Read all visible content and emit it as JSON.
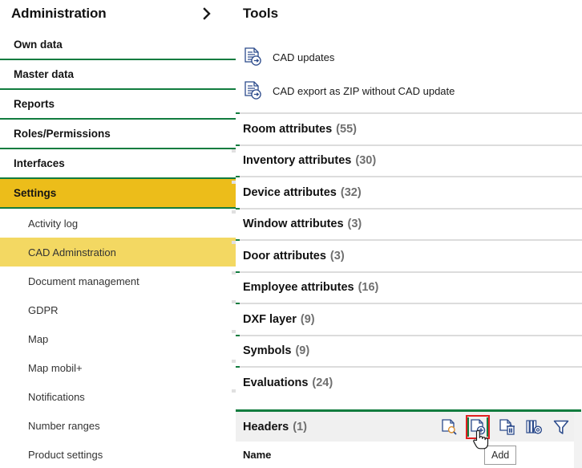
{
  "sidebar": {
    "title": "Administration",
    "expand_icon": "chevron-right-icon",
    "items": [
      {
        "label": "Own data",
        "level": "top",
        "active": false
      },
      {
        "label": "Master data",
        "level": "top",
        "active": false
      },
      {
        "label": "Reports",
        "level": "top",
        "active": false
      },
      {
        "label": "Roles/Permissions",
        "level": "top",
        "active": false
      },
      {
        "label": "Interfaces",
        "level": "top",
        "active": false
      },
      {
        "label": "Settings",
        "level": "top",
        "active": true
      },
      {
        "label": "Activity log",
        "level": "sub",
        "active": false
      },
      {
        "label": "CAD Adminstration",
        "level": "sub",
        "active": true
      },
      {
        "label": "Document management",
        "level": "sub",
        "active": false
      },
      {
        "label": "GDPR",
        "level": "sub",
        "active": false
      },
      {
        "label": "Map",
        "level": "sub",
        "active": false
      },
      {
        "label": "Map mobil+",
        "level": "sub",
        "active": false
      },
      {
        "label": "Notifications",
        "level": "sub",
        "active": false
      },
      {
        "label": "Number ranges",
        "level": "sub",
        "active": false
      },
      {
        "label": "Product settings",
        "level": "sub",
        "active": false
      }
    ]
  },
  "main": {
    "title": "Tools",
    "tools": [
      {
        "label": "CAD updates",
        "icon": "document-export-icon"
      },
      {
        "label": "CAD export as ZIP without CAD update",
        "icon": "document-export-icon"
      }
    ],
    "attributes": [
      {
        "label": "Room attributes",
        "count": "(55)"
      },
      {
        "label": "Inventory attributes",
        "count": "(30)"
      },
      {
        "label": "Device attributes",
        "count": "(32)"
      },
      {
        "label": "Window attributes",
        "count": "(3)"
      },
      {
        "label": "Door attributes",
        "count": "(3)"
      },
      {
        "label": "Employee attributes",
        "count": "(16)"
      },
      {
        "label": "DXF layer",
        "count": "(9)"
      },
      {
        "label": "Symbols",
        "count": "(9)"
      },
      {
        "label": "Evaluations",
        "count": "(24)"
      }
    ],
    "headers_section": {
      "label": "Headers",
      "count": "(1)",
      "column_name": "Name",
      "toolbar": [
        {
          "name": "view-document-icon",
          "title": "View",
          "selected": false
        },
        {
          "name": "add-document-icon",
          "title": "Add",
          "selected": true
        },
        {
          "name": "delete-document-icon",
          "title": "Delete",
          "selected": false
        },
        {
          "name": "column-settings-icon",
          "title": "Columns",
          "selected": false
        },
        {
          "name": "filter-icon",
          "title": "Filter",
          "selected": false
        }
      ]
    }
  },
  "tooltip": {
    "text": "Add"
  },
  "colors": {
    "accent_green": "#127c3f",
    "highlight_gold": "#ecbd1a",
    "highlight_gold_light": "#f3d862",
    "selection_red": "#e02020",
    "icon_blue": "#2b4a8b",
    "icon_orange": "#d98c2b",
    "header_bg": "#f0f0f0",
    "divider_gray": "#dcdcdc"
  }
}
